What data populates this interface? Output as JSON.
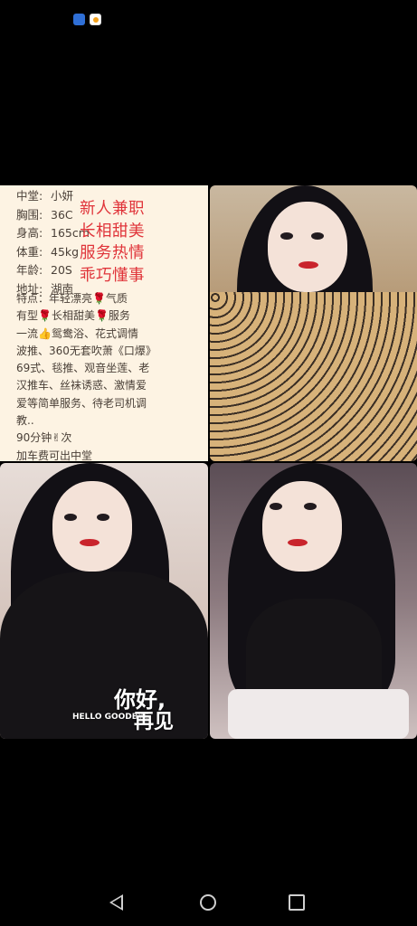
{
  "status_bar": {
    "icons": [
      "app-badge-icon",
      "browser-icon"
    ]
  },
  "profile": {
    "specs": [
      {
        "key": "中堂:",
        "value": "小妍"
      },
      {
        "key": "胸围:",
        "value": "36C"
      },
      {
        "key": "身高:",
        "value": "165cm"
      },
      {
        "key": "体重:",
        "value": "45kg"
      },
      {
        "key": "年龄:",
        "value": "20S"
      },
      {
        "key": "地址:",
        "value": "湖南"
      }
    ],
    "features_lines": [
      "特点：年轻漂亮🌹气质",
      "有型🌹长相甜美🌹服务",
      "一流👍鸳鸯浴、花式调情",
      "波推、360无套吹萧《口爆》",
      "69式、毯推、观音坐莲、老",
      "汉推车、丝袜诱惑、激情爱",
      "爱等简单服务、待老司机调",
      "教..",
      "90分钟✌次",
      "加车费可出中堂"
    ],
    "highlight_lines": [
      "新人兼职",
      "长相甜美",
      "服务热情",
      "乖巧懂事"
    ]
  },
  "photos": {
    "caption_main": "你好,",
    "caption_en": "HELLO GOODBYE",
    "caption_sub": "再见"
  },
  "nav_bar": {
    "icons": [
      "back-icon",
      "home-icon",
      "recent-apps-icon"
    ]
  }
}
